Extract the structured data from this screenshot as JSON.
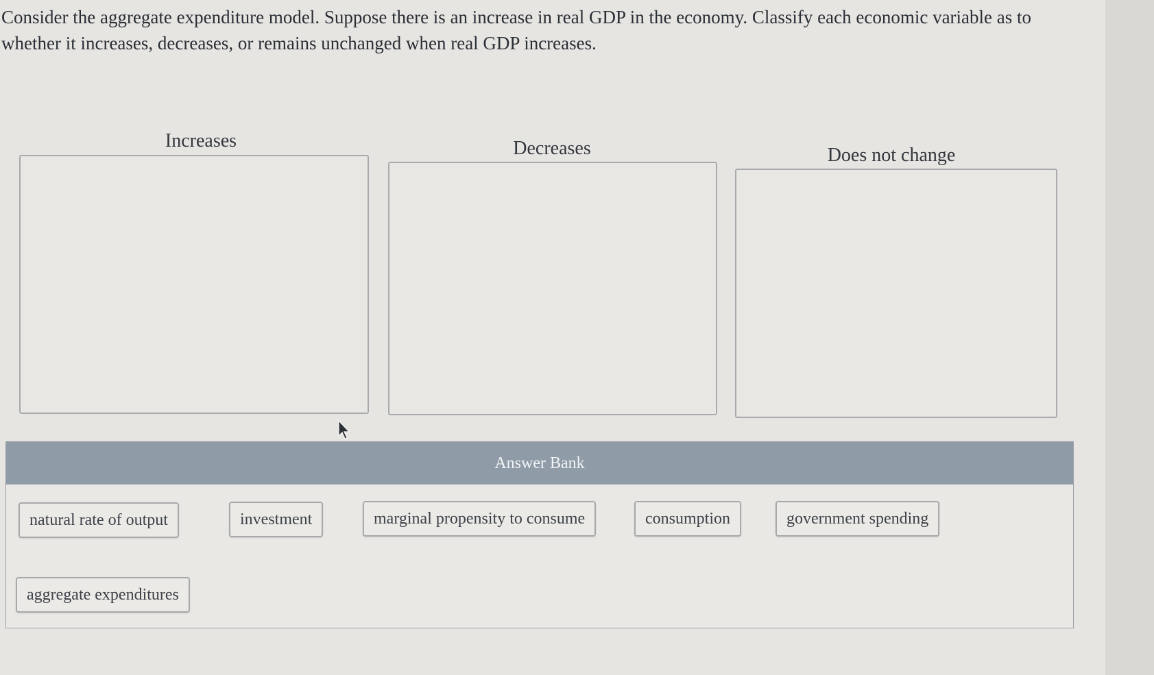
{
  "question": "Consider the aggregate expenditure model. Suppose there is an increase in real GDP in the economy. Classify each economic variable as to whether it increases, decreases, or remains unchanged when real GDP increases.",
  "columns": [
    {
      "label": "Increases"
    },
    {
      "label": "Decreases"
    },
    {
      "label": "Does not change"
    }
  ],
  "answer_bank": {
    "title": "Answer Bank",
    "items": [
      "natural rate of output",
      "investment",
      "marginal propensity to consume",
      "consumption",
      "government spending",
      "aggregate expenditures"
    ]
  },
  "icons": {
    "pointer": "mouse-pointer-icon"
  },
  "colors": {
    "bank_header": "#8f9ca8",
    "page": "#e6e5e2"
  }
}
